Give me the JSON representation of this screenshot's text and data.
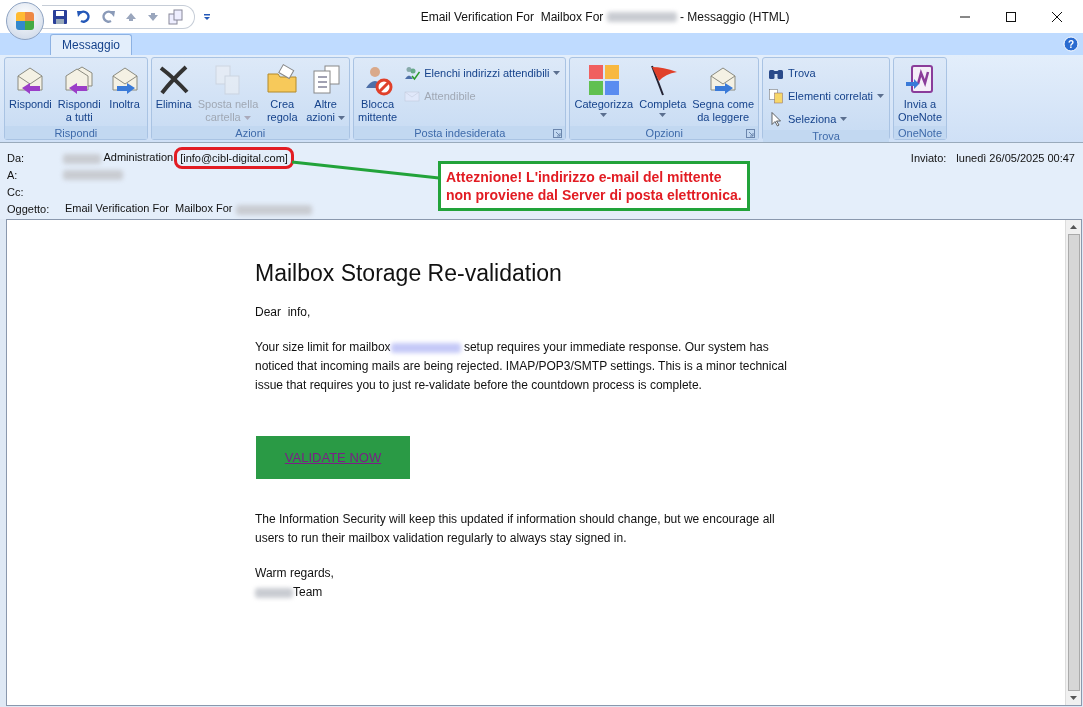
{
  "window": {
    "title_before": "Email Verification For  Mailbox For",
    "title_after": "- Messaggio (HTML)"
  },
  "tabs": [
    {
      "label": "Messaggio",
      "selected": true
    }
  ],
  "ribbon": {
    "help": "?",
    "groups": [
      {
        "title": "Rispondi",
        "launcher": false,
        "buttons": [
          {
            "kind": "large",
            "label": "Rispondi",
            "disabled": false,
            "dropdown": false
          },
          {
            "kind": "large",
            "label": "Rispondi\na tutti",
            "disabled": false,
            "dropdown": false
          },
          {
            "kind": "large",
            "label": "Inoltra",
            "disabled": false,
            "dropdown": false
          }
        ]
      },
      {
        "title": "Azioni",
        "launcher": false,
        "buttons": [
          {
            "kind": "large",
            "label": "Elimina",
            "disabled": false,
            "dropdown": false
          },
          {
            "kind": "large",
            "label": "Sposta nella\ncartella",
            "disabled": true,
            "dropdown": true
          },
          {
            "kind": "large",
            "label": "Crea\nregola",
            "disabled": false,
            "dropdown": false
          },
          {
            "kind": "large",
            "label": "Altre\nazioni",
            "disabled": false,
            "dropdown": true
          }
        ]
      },
      {
        "title": "Posta indesiderata",
        "launcher": true,
        "buttons": [
          {
            "kind": "large",
            "label": "Blocca\nmittente",
            "disabled": false,
            "dropdown": false
          },
          {
            "kind": "small",
            "label": "Elenchi indirizzi attendibili",
            "disabled": false,
            "dropdown": true
          },
          {
            "kind": "small",
            "label": "Attendibile",
            "disabled": true,
            "dropdown": false
          }
        ]
      },
      {
        "title": "Opzioni",
        "launcher": true,
        "buttons": [
          {
            "kind": "large",
            "label": "Categorizza",
            "disabled": false,
            "dropdown": true
          },
          {
            "kind": "large",
            "label": "Completa",
            "disabled": false,
            "dropdown": true
          },
          {
            "kind": "large",
            "label": "Segna come\nda leggere",
            "disabled": false,
            "dropdown": false
          }
        ]
      },
      {
        "title": "Trova",
        "launcher": false,
        "buttons": [
          {
            "kind": "small",
            "label": "Trova",
            "disabled": false,
            "dropdown": false
          },
          {
            "kind": "small",
            "label": "Elementi correlati",
            "disabled": false,
            "dropdown": true
          },
          {
            "kind": "small",
            "label": "Seleziona",
            "disabled": false,
            "dropdown": true
          }
        ]
      },
      {
        "title": "OneNote",
        "launcher": false,
        "buttons": [
          {
            "kind": "large",
            "label": "Invia a\nOneNote",
            "disabled": false,
            "dropdown": false
          }
        ]
      }
    ]
  },
  "header": {
    "from": {
      "label": "Da:",
      "name": "Administration",
      "address": "[info@cibl-digital.com]"
    },
    "to": {
      "label": "A:"
    },
    "cc": {
      "label": "Cc:"
    },
    "subject": {
      "label": "Oggetto:",
      "value": "Email Verification For  Mailbox For"
    },
    "sent": {
      "label": "Inviato:",
      "value": "lunedì 26/05/2025 00:47"
    }
  },
  "warning": {
    "text": "Atteznione! L'indirizzo e-mail del mittente\nnon proviene dal Server di posta elettronica."
  },
  "body": {
    "heading": "Mailbox Storage Re-validation",
    "greeting": "Dear  info,",
    "paragraph_1_before": "Your size limit for mailbox",
    "paragraph_1_after": "setup requires your immediate response. Our system has noticed that incoming mails are being rejected. IMAP/POP3/SMTP settings. This is a minor technical issue that requires you to just re-validate before the countdown process is complete.",
    "button": "VALIDATE NOW",
    "paragraph_2": "The Information Security will keep this updated if information should change, but we encourage all users to run their mailbox validation regularly to always stay signed in.",
    "closing": "Warm regards,",
    "signature": "Team"
  }
}
